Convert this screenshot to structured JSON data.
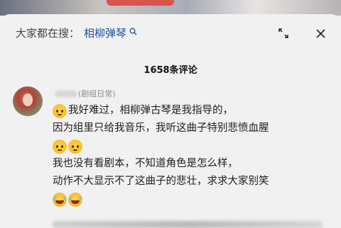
{
  "search": {
    "prefix": "大家都在搜：",
    "term": "相柳弹琴",
    "icon": "search-icon"
  },
  "header": {
    "expand_icon": "expand-icon",
    "close_icon": "close-icon"
  },
  "comments_count_title": "1658条评论",
  "comment": {
    "username_suffix": "(剧组日常)",
    "lines": [
      "我好难过，相柳弹古琴是我指导的，",
      "因为组里只给我音乐，我听这曲子特别悲愤血腥",
      "我也没有看剧本，不知道角色是怎么样，",
      "动作不大显示不了这曲子的悲壮，求求大家别笑"
    ],
    "emojis": [
      "worried-face",
      "worried-face",
      "worried-face",
      "laughing-tears",
      "laughing-tears"
    ]
  },
  "colors": {
    "link": "#1f4f9a",
    "background": "#f1f1f1"
  }
}
